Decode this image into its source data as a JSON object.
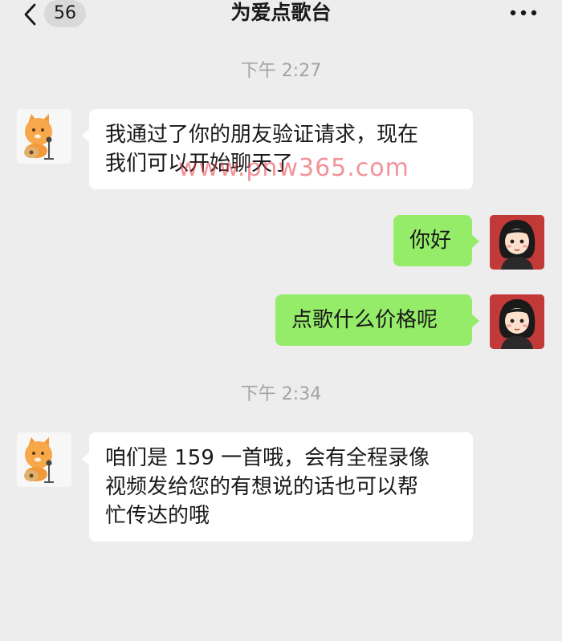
{
  "header": {
    "unread_count": "56",
    "title": "为爱点歌台"
  },
  "messages": [
    {
      "time": "下午 2:27"
    },
    {
      "from": "other",
      "lines": [
        "我通过了你的朋友验证请求，现在",
        "我们可以开始聊天了"
      ]
    },
    {
      "from": "me",
      "text": "你好"
    },
    {
      "from": "me",
      "text": "点歌什么价格呢"
    },
    {
      "time": "下午 2:34"
    },
    {
      "from": "other",
      "lines": [
        "咱们是 159 一首哦，会有全程录像",
        "视频发给您的有想说的话也可以帮",
        "忙传达的哦"
      ]
    }
  ],
  "watermark": "www.pnw365.com",
  "icons": {
    "back": "chevron-left-icon",
    "more": "more-dots-icon"
  },
  "colors": {
    "background": "#ededed",
    "bubble_me": "#95ec69",
    "bubble_other": "#ffffff",
    "time_text": "#a3a3a3"
  }
}
